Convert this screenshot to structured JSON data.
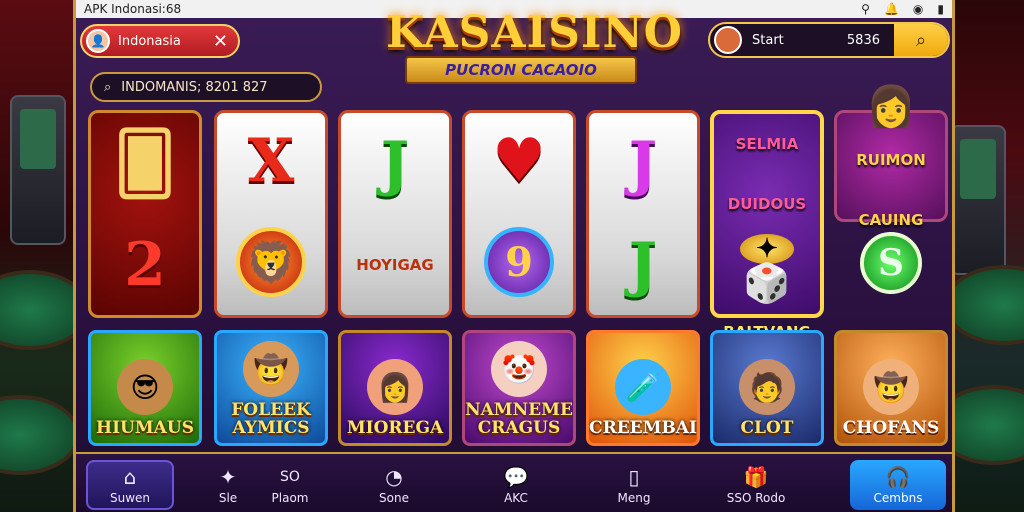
{
  "status_bar": {
    "left": "APK  Indonasi:68"
  },
  "location": {
    "label": "Indonasia",
    "close": "✕"
  },
  "search": {
    "value": "INDOMANIS;  8201 827"
  },
  "logo": {
    "title": "KASAISINO",
    "ribbon": "PUCRON CACAOIO"
  },
  "user": {
    "name": "Start",
    "balance": "5836"
  },
  "reels": [
    {
      "top": "🂠",
      "bottom": "2"
    },
    {
      "top": "X",
      "bottom": "🦁"
    },
    {
      "top": "J",
      "bottom_label": "HOYIGAG"
    },
    {
      "top": "♥",
      "bottom": "9"
    },
    {
      "top": "J",
      "bottom": "J"
    },
    {
      "top_label": "SELMIA DUIDOUS",
      "bottom_label": "BALTVANG"
    },
    {
      "top_label": "RUIMON CAUING",
      "bottom": "S"
    }
  ],
  "tiles": [
    {
      "name": "HIUMAUS"
    },
    {
      "name": "FOLEEK AYMICS"
    },
    {
      "name": "MIOREGA"
    },
    {
      "name": "NAMNEME CRAGUS"
    },
    {
      "name": "CREEMBAI"
    },
    {
      "name": "CLOT"
    },
    {
      "name": "CHOFANS"
    }
  ],
  "nav": [
    {
      "label": "Suwen",
      "icon": "home-icon"
    },
    {
      "label": "Sle",
      "icon": "star-icon"
    },
    {
      "label": "Plaom",
      "top": "SO"
    },
    {
      "label": "Sone",
      "icon": "clock-icon"
    },
    {
      "label": "AKC",
      "icon": "chat-icon"
    },
    {
      "label": "Meng",
      "icon": "door-icon"
    },
    {
      "label": "SSO Rodo",
      "icon": "gift-icon"
    },
    {
      "label": "Cembns",
      "icon": "support-icon"
    }
  ]
}
